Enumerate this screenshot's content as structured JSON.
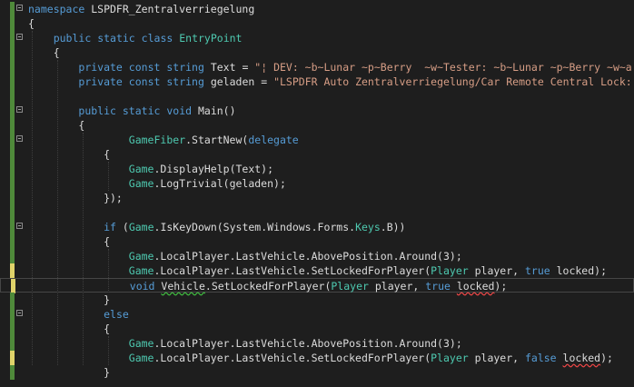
{
  "editor": {
    "lines": [
      {
        "tokens": [
          {
            "t": "namespace",
            "c": "t-kw"
          },
          {
            "t": " LSPDFR_Zentralverriegelung",
            "c": "t-txt"
          }
        ]
      },
      {
        "tokens": [
          {
            "t": "{",
            "c": "t-txt"
          }
        ]
      },
      {
        "tokens": [
          {
            "t": "    ",
            "c": "t-txt"
          },
          {
            "t": "public",
            "c": "t-kw"
          },
          {
            "t": " ",
            "c": "t-txt"
          },
          {
            "t": "static",
            "c": "t-kw"
          },
          {
            "t": " ",
            "c": "t-txt"
          },
          {
            "t": "class",
            "c": "t-kw"
          },
          {
            "t": " ",
            "c": "t-txt"
          },
          {
            "t": "EntryPoint",
            "c": "t-type"
          }
        ]
      },
      {
        "tokens": [
          {
            "t": "    {",
            "c": "t-txt"
          }
        ]
      },
      {
        "tokens": [
          {
            "t": "        ",
            "c": "t-txt"
          },
          {
            "t": "private",
            "c": "t-kw"
          },
          {
            "t": " ",
            "c": "t-txt"
          },
          {
            "t": "const",
            "c": "t-kw"
          },
          {
            "t": " ",
            "c": "t-txt"
          },
          {
            "t": "string",
            "c": "t-kw"
          },
          {
            "t": " Text = ",
            "c": "t-txt"
          },
          {
            "t": "\"¦ DEV: ~b~Lunar ~p~Berry  ~w~Tester: ~b~Lunar ~p~Berry ~w~a",
            "c": "t-str"
          }
        ]
      },
      {
        "tokens": [
          {
            "t": "        ",
            "c": "t-txt"
          },
          {
            "t": "private",
            "c": "t-kw"
          },
          {
            "t": " ",
            "c": "t-txt"
          },
          {
            "t": "const",
            "c": "t-kw"
          },
          {
            "t": " ",
            "c": "t-txt"
          },
          {
            "t": "string",
            "c": "t-kw"
          },
          {
            "t": " geladen = ",
            "c": "t-txt"
          },
          {
            "t": "\"LSPDFR Auto Zentralverriegelung/Car Remote Central Lock:",
            "c": "t-str"
          }
        ]
      },
      {
        "tokens": []
      },
      {
        "tokens": [
          {
            "t": "        ",
            "c": "t-txt"
          },
          {
            "t": "public",
            "c": "t-kw"
          },
          {
            "t": " ",
            "c": "t-txt"
          },
          {
            "t": "static",
            "c": "t-kw"
          },
          {
            "t": " ",
            "c": "t-txt"
          },
          {
            "t": "void",
            "c": "t-kw"
          },
          {
            "t": " Main()",
            "c": "t-txt"
          }
        ]
      },
      {
        "tokens": [
          {
            "t": "        {",
            "c": "t-txt"
          }
        ]
      },
      {
        "tokens": [
          {
            "t": "                ",
            "c": "t-txt"
          },
          {
            "t": "GameFiber",
            "c": "t-type"
          },
          {
            "t": ".StartNew(",
            "c": "t-txt"
          },
          {
            "t": "delegate",
            "c": "t-kw"
          }
        ]
      },
      {
        "tokens": [
          {
            "t": "            {",
            "c": "t-txt"
          }
        ]
      },
      {
        "tokens": [
          {
            "t": "                ",
            "c": "t-txt"
          },
          {
            "t": "Game",
            "c": "t-type"
          },
          {
            "t": ".DisplayHelp(Text);",
            "c": "t-txt"
          }
        ]
      },
      {
        "tokens": [
          {
            "t": "                ",
            "c": "t-txt"
          },
          {
            "t": "Game",
            "c": "t-type"
          },
          {
            "t": ".LogTrivial(geladen);",
            "c": "t-txt"
          }
        ]
      },
      {
        "tokens": [
          {
            "t": "            });",
            "c": "t-txt"
          }
        ]
      },
      {
        "tokens": []
      },
      {
        "tokens": [
          {
            "t": "            ",
            "c": "t-txt"
          },
          {
            "t": "if",
            "c": "t-kw"
          },
          {
            "t": " (",
            "c": "t-txt"
          },
          {
            "t": "Game",
            "c": "t-type"
          },
          {
            "t": ".IsKeyDown(System.Windows.Forms.",
            "c": "t-txt"
          },
          {
            "t": "Keys",
            "c": "t-type"
          },
          {
            "t": ".B))",
            "c": "t-txt"
          }
        ]
      },
      {
        "tokens": [
          {
            "t": "            {",
            "c": "t-txt"
          }
        ]
      },
      {
        "tokens": [
          {
            "t": "                ",
            "c": "t-txt"
          },
          {
            "t": "Game",
            "c": "t-type"
          },
          {
            "t": ".LocalPlayer.LastVehicle.AbovePosition.Around(3);",
            "c": "t-txt"
          }
        ]
      },
      {
        "tokens": [
          {
            "t": "                ",
            "c": "t-txt"
          },
          {
            "t": "Game",
            "c": "t-type"
          },
          {
            "t": ".LocalPlayer.LastVehicle.SetLockedForPlayer(",
            "c": "t-txt"
          },
          {
            "t": "Player",
            "c": "t-type"
          },
          {
            "t": " player, ",
            "c": "t-txt"
          },
          {
            "t": "true",
            "c": "t-kw"
          },
          {
            "t": " locked);",
            "c": "t-txt"
          }
        ]
      },
      {
        "tokens": [
          {
            "t": "                ",
            "c": "t-txt"
          },
          {
            "t": "void",
            "c": "t-kw"
          },
          {
            "t": " ",
            "c": "t-txt"
          },
          {
            "t": "Vehicle",
            "c": "t-txt",
            "sq": "g"
          },
          {
            "t": ".SetLockedForPlayer(",
            "c": "t-txt"
          },
          {
            "t": "Player",
            "c": "t-type"
          },
          {
            "t": " player, ",
            "c": "t-txt"
          },
          {
            "t": "true",
            "c": "t-kw"
          },
          {
            "t": " ",
            "c": "t-txt"
          },
          {
            "t": "locked",
            "c": "t-txt",
            "sq": "r"
          },
          {
            "t": ");",
            "c": "t-txt"
          }
        ]
      },
      {
        "tokens": [
          {
            "t": "            }",
            "c": "t-txt"
          }
        ]
      },
      {
        "tokens": [
          {
            "t": "            ",
            "c": "t-txt"
          },
          {
            "t": "else",
            "c": "t-kw"
          }
        ]
      },
      {
        "tokens": [
          {
            "t": "            {",
            "c": "t-txt"
          }
        ]
      },
      {
        "tokens": [
          {
            "t": "                ",
            "c": "t-txt"
          },
          {
            "t": "Game",
            "c": "t-type"
          },
          {
            "t": ".LocalPlayer.LastVehicle.AbovePosition.Around(3);",
            "c": "t-txt"
          }
        ]
      },
      {
        "tokens": [
          {
            "t": "                ",
            "c": "t-txt"
          },
          {
            "t": "Game",
            "c": "t-type"
          },
          {
            "t": ".LocalPlayer.LastVehicle.SetLockedForPlayer(",
            "c": "t-txt"
          },
          {
            "t": "Player",
            "c": "t-type"
          },
          {
            "t": " player, ",
            "c": "t-txt"
          },
          {
            "t": "false",
            "c": "t-kw"
          },
          {
            "t": " ",
            "c": "t-txt"
          },
          {
            "t": "locked",
            "c": "t-txt",
            "sq": "r"
          },
          {
            "t": ");",
            "c": "t-txt"
          }
        ]
      },
      {
        "tokens": [
          {
            "t": "            }",
            "c": "t-txt"
          }
        ]
      }
    ],
    "folds": [
      0,
      2,
      7,
      9,
      15,
      21
    ],
    "gutter": {
      "green": [
        0,
        1,
        2,
        3,
        4,
        5,
        6,
        7,
        8,
        9,
        10,
        11,
        12,
        13,
        14,
        15,
        16,
        17,
        20,
        21,
        22,
        23,
        25,
        26
      ],
      "yellow": [
        18,
        19,
        24
      ]
    },
    "current_line": 19,
    "colors": {
      "background": "#1e1e1e",
      "keyword": "#569cd6",
      "type": "#4ec9b0",
      "string": "#d69d85",
      "text": "#dcdcdc",
      "saved_change": "#4f8a3a",
      "unsaved_change": "#e0d36a"
    }
  }
}
